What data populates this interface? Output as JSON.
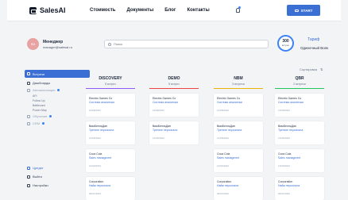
{
  "brand": {
    "name": "SalesAI"
  },
  "nav": [
    "Стоимость",
    "Документы",
    "Блог",
    "Контакты"
  ],
  "start_button": "START",
  "profile": {
    "initials": "RM",
    "role": "Менеджер",
    "email": "manager@salesai.ru"
  },
  "search": {
    "placeholder": "Поиск"
  },
  "tariff": {
    "count": "300",
    "unit": "встреч",
    "label": "Тариф",
    "value": "Одиночный Волк"
  },
  "sidebar": {
    "items": [
      {
        "label": "Встречи"
      },
      {
        "label": "Дашбоарды"
      },
      {
        "label": "Автоматизация"
      },
      {
        "label": "Обучение"
      },
      {
        "label": "CRM"
      }
    ],
    "subitems": [
      "AFI",
      "Follow Up",
      "Battlecard",
      "Power Map"
    ],
    "bottom": [
      "Цредит",
      "Выйти",
      "Настройки"
    ]
  },
  "sort_label": "Сортировка",
  "columns": [
    {
      "title": "DISCOVERY",
      "count": "5 встреч",
      "color": "#8b5cf6",
      "cards": [
        {
          "company": "Electric Games Co",
          "project": "Система аналитики",
          "date": "12/08/2022"
        },
        {
          "company": "ВимБелльДан",
          "project": "Тренинг персонала",
          "date": "12/05/2022"
        },
        {
          "company": "Coca Cola",
          "project": "Sales managment",
          "date": "12/03/2022"
        },
        {
          "company": "Corporation",
          "project": "Найм персонала",
          "date": "05/07/2022"
        }
      ]
    },
    {
      "title": "DEMO",
      "count": "5 встреч",
      "color": "#ef4444",
      "cards": [
        {
          "company": "Electric Games Co",
          "project": "Система аналитики",
          "date": "12/08/2022"
        },
        {
          "company": "ВимБелльДан",
          "project": "Тренинг персонала",
          "date": "12/05/2022"
        }
      ]
    },
    {
      "title": "NBM",
      "count": "3 встречи",
      "color": "#eab308",
      "cards": [
        {
          "company": "Electric Games Co",
          "project": "Система аналитики",
          "date": "12/08/2022"
        },
        {
          "company": "ВимБелльДан",
          "project": "Тренинг персонала",
          "date": "12/05/2022"
        },
        {
          "company": "Coca Cola",
          "project": "Sales managment",
          "date": "12/03/2022"
        },
        {
          "company": "Corporation",
          "project": "Найм персонала",
          "date": "05/07/2022"
        }
      ]
    },
    {
      "title": "QBR",
      "count": "2 встречи",
      "color": "#22c55e",
      "cards": [
        {
          "company": "Electric Games Co",
          "project": "Система аналитики",
          "date": "12/08/2022"
        },
        {
          "company": "ВимБелльДан",
          "project": "Тренинг персонала",
          "date": "12/05/2022"
        },
        {
          "company": "Coca Cola",
          "project": "Sales managment",
          "date": "12/03/2022"
        },
        {
          "company": "Corporation",
          "project": "Найм персонала",
          "date": "05/07/2022"
        }
      ]
    }
  ]
}
